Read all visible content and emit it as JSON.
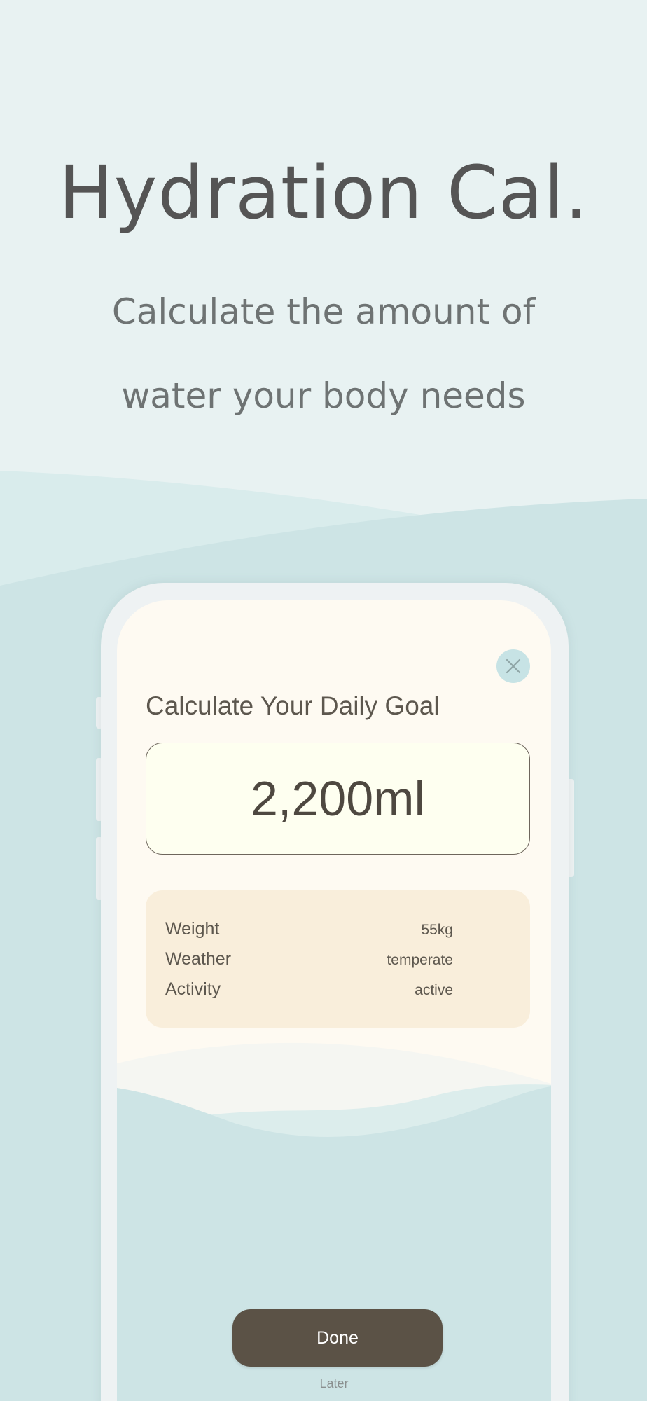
{
  "promo": {
    "headline": "Hydration Cal.",
    "subline_1": "Calculate the amount of",
    "subline_2": "water your body needs"
  },
  "modal": {
    "title": "Calculate Your Daily Goal",
    "goal_value": "2,200ml",
    "close_icon": "close-icon",
    "details": [
      {
        "label": "Weight",
        "value": "55kg"
      },
      {
        "label": "Weather",
        "value": "temperate"
      },
      {
        "label": "Activity",
        "value": "active"
      }
    ],
    "done_label": "Done",
    "later_label": "Later"
  },
  "colors": {
    "background": "#e8f2f2",
    "wave_light": "#d9ecec",
    "wave_main": "#cde4e5",
    "screen_bg": "#fefaf2",
    "goal_box_bg": "#fefff0",
    "details_bg": "#f9eedb",
    "done_button": "#5b5246",
    "close_button": "#c7e3e5",
    "text_dark": "#555555"
  }
}
